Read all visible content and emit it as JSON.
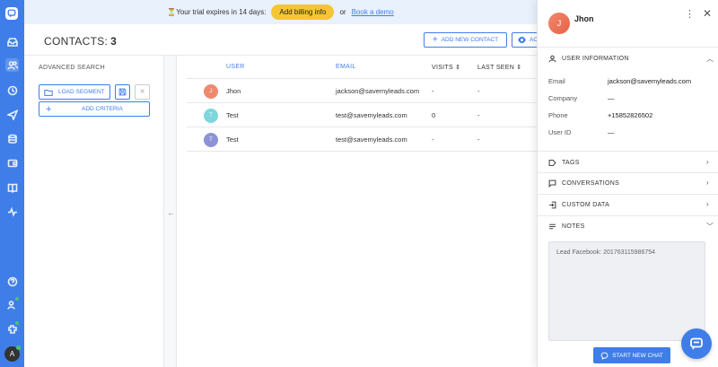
{
  "banner": {
    "trial_text": "⏳Your trial expires in 14 days:",
    "billing_label": "Add billing info",
    "or_text": "or",
    "demo_label": "Book a demo"
  },
  "header": {
    "title": "CONTACTS:",
    "count": "3",
    "add_contact_label": "ADD NEW CONTACT",
    "actions_label": "AC"
  },
  "advanced_search": {
    "title": "ADVANCED SEARCH",
    "load_segment_label": "LOAD SEGMENT",
    "add_criteria_label": "ADD CRITERIA"
  },
  "table": {
    "columns": {
      "user": "USER",
      "email": "EMAIL",
      "visits": "VISITS ⇕",
      "last_seen": "LAST SEEN ⇕"
    },
    "rows": [
      {
        "initial": "J",
        "name": "Jhon",
        "email": "jackson@savemyleads.com",
        "visits": "-",
        "last_seen": "-",
        "color": "#ee8a6e"
      },
      {
        "initial": "T",
        "name": "Test",
        "email": "test@savemyleads.com",
        "visits": "0",
        "last_seen": "-",
        "color": "#7fd6dc"
      },
      {
        "initial": "T",
        "name": "Test",
        "email": "test@savemyleads.com",
        "visits": "-",
        "last_seen": "-",
        "color": "#8e92d6"
      }
    ]
  },
  "drawer": {
    "initial": "J",
    "name": "Jhon",
    "user_info_title": "USER INFORMATION",
    "fields": {
      "email_label": "Email",
      "email_value": "jackson@savemyleads.com",
      "company_label": "Company",
      "company_value": "—",
      "phone_label": "Phone",
      "phone_value": "+15852826502",
      "user_id_label": "User ID",
      "user_id_value": "—"
    },
    "tags_title": "TAGS",
    "conversations_title": "CONVERSATIONS",
    "custom_data_title": "CUSTOM DATA",
    "notes_title": "NOTES",
    "notes_text": "Lead Facebook: 201763115986754",
    "start_chat_label": "START NEW CHAT"
  },
  "rail": {
    "avatar_initial": "A"
  },
  "colors": {
    "accent": "#3f7ee8",
    "billing": "#f6c532",
    "online": "#46c46b"
  }
}
